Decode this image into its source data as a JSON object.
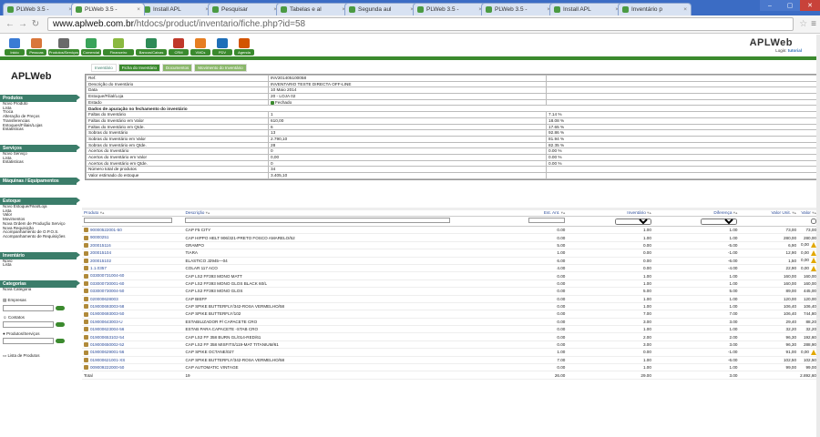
{
  "browser": {
    "tabs": [
      {
        "title": "PLWeb 3.5 -",
        "active": false
      },
      {
        "title": "PLWeb 3.5 -",
        "active": true
      },
      {
        "title": "Install APL",
        "active": false
      },
      {
        "title": "Pesquisar",
        "active": false
      },
      {
        "title": "Tabelas e al",
        "active": false
      },
      {
        "title": "Segunda aul",
        "active": false
      },
      {
        "title": "PLWeb 3.5 -",
        "active": false
      },
      {
        "title": "PLWeb 3.5 -",
        "active": false
      },
      {
        "title": "Install APL",
        "active": false
      },
      {
        "title": "Inventário p",
        "active": false
      }
    ],
    "url_host": "www.aplweb.com.br",
    "url_path": "/htdocs/product/inventario/fiche.php?id=58"
  },
  "app": {
    "modules": [
      "Inicio",
      "Pessoas",
      "Produtos/Serviços",
      "Comercial",
      "Financeiro",
      "Bancos/Caixas",
      "CRM",
      "VMCs",
      "PDV",
      "Agenda"
    ],
    "logo": "APLWeb",
    "login_label": "Login:",
    "login_user": "tutorial"
  },
  "sidebar": {
    "logo": "APLWeb",
    "sections": [
      {
        "title": "Produtos",
        "items": [
          "Novo Produto",
          "Lista",
          "Troca",
          "Alteração de Preços",
          "Transferencias",
          "Estoques/Filiais/Lojas",
          "Estatisticas"
        ]
      },
      {
        "title": "Serviços",
        "items": [
          "Novo Serviço",
          "Lista",
          "Estatisticas"
        ]
      },
      {
        "title": "Máquinas / Equipamentos",
        "items": []
      },
      {
        "title": "Estoque",
        "items": [
          "Novo Estoque/Filial/Loja",
          "Lista",
          "Valor",
          "Movimentos",
          "Nova Ordem de Produção Serviço",
          "Nova Requisição",
          "Acompanhamento de O.P.O.S.",
          "Acompanhamento de Requisições"
        ]
      },
      {
        "title": "Inventário",
        "items": [
          "Novo",
          "Lista"
        ]
      },
      {
        "title": "Categorias",
        "items": [
          "Nova Categoria"
        ]
      }
    ],
    "search": {
      "empresas": "Empresas",
      "contatos": "Contatos",
      "produtos": "Produtos/Serviços",
      "lista_precos": "Lista de Produtos"
    }
  },
  "content": {
    "tabs": [
      "Inventário",
      "Ficha do Inventário",
      "Documentos",
      "Movimento do Inventário"
    ],
    "detail": [
      [
        "Ref.",
        "INV201405100058",
        ""
      ],
      [
        "Descrição do Inventário",
        "INVENTARIO TESTE DIRECTA OFF-LINE",
        ""
      ],
      [
        "Data",
        "10 Maio 2014",
        ""
      ],
      [
        "Estoque/Filial/Loja",
        "20 - LOJA 02",
        ""
      ],
      [
        "Estado",
        "Fechado",
        ""
      ],
      [
        "Dados de apuração no fechamento do inventário",
        "",
        ""
      ],
      [
        "Faltas do Inventário",
        "1",
        "7.14 %"
      ],
      [
        "Faltas do Inventário em Valor",
        "610,00",
        "18.08 %"
      ],
      [
        "Faltas do Inventário em Qtde.",
        "6",
        "17.65 %"
      ],
      [
        "Sobras do Inventário",
        "13",
        "92.86 %"
      ],
      [
        "Sobras do Inventário em Valor",
        "2.790,10",
        "81.94 %"
      ],
      [
        "Sobras do Inventário em Qtde.",
        "28",
        "82.35 %"
      ],
      [
        "Acertos do Inventário",
        "0",
        "0.00 %"
      ],
      [
        "Acertos do Inventário em Valor",
        "0,00",
        "0.00 %"
      ],
      [
        "Acertos do Inventário em Qtde.",
        "0",
        "0.00 %"
      ],
      [
        "Número total de produtos",
        "34",
        ""
      ],
      [
        "Valor estimado do estoque",
        "3.405,10",
        ""
      ]
    ],
    "columns": [
      "Produto",
      "Descrição",
      "Est. Ant.",
      "Inventário",
      "Diferença",
      "Valor Unit.",
      "Valor"
    ],
    "rows": [
      [
        "90000522001-50",
        "CAP F5 CITY",
        "0.00",
        "1.00",
        "1.00",
        "73,00",
        "73,00",
        false
      ],
      [
        "90000251",
        "CAP HIPPO HELT 906/321-PRETO FOSCO AMARELO/52",
        "0.00",
        "1.00",
        "1.00",
        "280,00",
        "280,00",
        false
      ],
      [
        "200015116",
        "GRAMPO",
        "5.00",
        "0.00",
        "-5.00",
        "6,90",
        "0,00",
        true
      ],
      [
        "200015104",
        "TIARA",
        "1.00",
        "0.00",
        "-1.00",
        "12,90",
        "0,00",
        true
      ],
      [
        "200015102",
        "ELASTICO J2945—04",
        "6.00",
        "0.00",
        "-6.00",
        "1,50",
        "0,00",
        true
      ],
      [
        "1.1.0357",
        "COLAR 117 ACO",
        "4.00",
        "0.00",
        "-4.00",
        "22,90",
        "0,00",
        true
      ],
      [
        "033000731004-60",
        "CAP LS2 FF393 MONO MATT",
        "0.00",
        "1.00",
        "1.00",
        "160,00",
        "160,00",
        false
      ],
      [
        "033000730001-60",
        "CAP LS2 FF393 MONO GLOS BLACK 60/L",
        "0.00",
        "1.00",
        "1.00",
        "160,00",
        "160,00",
        false
      ],
      [
        "033000730004-50",
        "CAP LS2 FF393 MONO GLOS",
        "0.00",
        "5.00",
        "5.00",
        "89,00",
        "445,00",
        false
      ],
      [
        "020000628003",
        "CAP BIEFF",
        "0.00",
        "1.00",
        "1.00",
        "120,00",
        "120,00",
        false
      ],
      [
        "019000693003-58",
        "CAP SPIKE BUTTERFLY/342-ROSA VERMELHO/58",
        "0.00",
        "1.00",
        "1.00",
        "106,40",
        "106,40",
        false
      ],
      [
        "019000693003-50",
        "CAP SPIKE BUTTERFLY/102",
        "0.00",
        "7.00",
        "7.00",
        "106,40",
        "744,80",
        false
      ],
      [
        "019000643003-U",
        "ESTABILIZADOR P/ CAPACETE CRO",
        "0.00",
        "3.00",
        "3.00",
        "29,40",
        "88,20",
        false
      ],
      [
        "019000623004-56",
        "ESTAB PARA CAPACETE -STAB CRO",
        "0.00",
        "1.00",
        "1.00",
        "32,20",
        "32,20",
        false
      ],
      [
        "019000653102-54",
        "CAP LS2 FF 358 BURN GL/014-RED/61",
        "0.00",
        "2.00",
        "2.00",
        "96,30",
        "192,60",
        false
      ],
      [
        "019000650002-52",
        "CAP LS2 FF 358 MISFITS/119-MAT TITANIUM/61",
        "0.00",
        "3.00",
        "3.00",
        "96,30",
        "288,90",
        false
      ],
      [
        "019000629001-56",
        "CAP SPIKE OCTANE/027",
        "1.00",
        "0.00",
        "-1.00",
        "91,00",
        "0,00",
        true
      ],
      [
        "019000621001-XS",
        "CAP SPIKE BUTTERFLY/342-ROSA VERMELHO/58",
        "7.00",
        "1.00",
        "-6.00",
        "102,50",
        "102,50",
        false
      ],
      [
        "009009222000-50",
        "CAP AUTOMATIC VINTAGE",
        "0.00",
        "1.00",
        "1.00",
        "99,00",
        "99,00",
        false
      ]
    ],
    "total": [
      "Total",
      "19",
      "26.00",
      "29.00",
      "3.00",
      "",
      "2.892,60"
    ]
  }
}
